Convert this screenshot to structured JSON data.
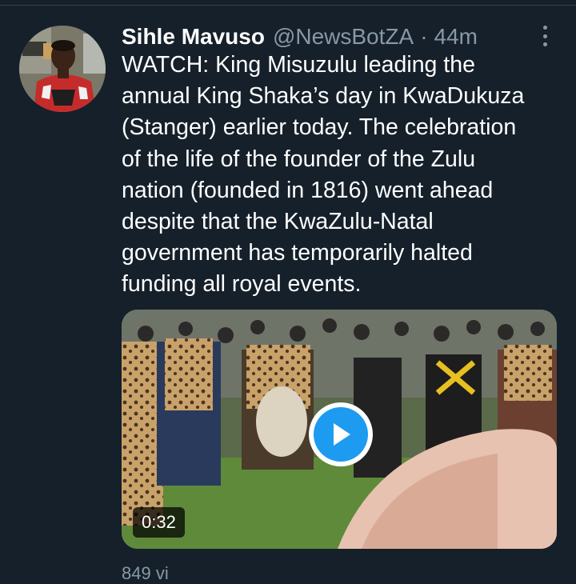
{
  "tweet": {
    "author_name": "Sihle Mavuso",
    "handle": "@NewsBotZA",
    "separator": "·",
    "time": "44m",
    "text": "WATCH: King Misuzulu leading the\nannual King Shaka’s day in KwaDukuza\n(Stanger) earlier today. The celebration\nof the life of the founder of the Zulu\nnation (founded in 1816) went ahead\ndespite that the KwaZulu-Natal\ngovernment has temporarily halted\nfunding all royal events.",
    "more_icon": "vertical-ellipsis-icon"
  },
  "video": {
    "duration": "0:32",
    "play_icon": "play-icon"
  },
  "footer": {
    "views_partial": "849 vi"
  },
  "colors": {
    "background": "#15202b",
    "secondary_text": "#8899a6",
    "accent": "#1d9bf0"
  }
}
